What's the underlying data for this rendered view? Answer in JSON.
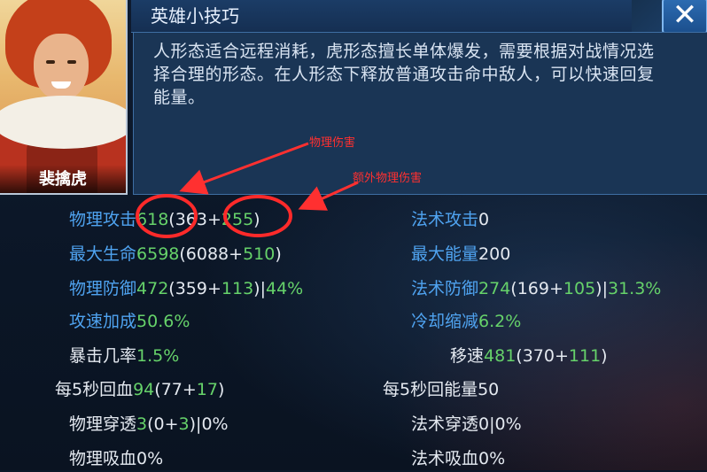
{
  "hero": {
    "name": "裴擒虎"
  },
  "tips": {
    "title": "英雄小技巧",
    "text": "人形态适合远程消耗，虎形态擅长单体爆发，需要根据对战情况选择合理的形态。在人形态下释放普通攻击命中敌人，可以快速回复能量。",
    "close_label": "✕"
  },
  "annotations": {
    "physical_damage": "物理伤害",
    "extra_physical_damage": "额外物理伤害"
  },
  "stats_left": [
    {
      "label": "物理攻击",
      "label_color": "blue",
      "parts": [
        {
          "t": "618",
          "c": "green"
        },
        {
          "t": "(363+",
          "c": "white"
        },
        {
          "t": "255",
          "c": "green"
        },
        {
          "t": ")",
          "c": "white"
        }
      ]
    },
    {
      "label": "最大生命",
      "label_color": "blue",
      "parts": [
        {
          "t": "6598",
          "c": "green"
        },
        {
          "t": "(6088+",
          "c": "white"
        },
        {
          "t": "510",
          "c": "green"
        },
        {
          "t": ")",
          "c": "white"
        }
      ]
    },
    {
      "label": "物理防御",
      "label_color": "blue",
      "parts": [
        {
          "t": "472",
          "c": "green"
        },
        {
          "t": "(359+",
          "c": "white"
        },
        {
          "t": "113",
          "c": "green"
        },
        {
          "t": ")|",
          "c": "white"
        },
        {
          "t": "44%",
          "c": "green"
        }
      ]
    },
    {
      "label": "攻速加成",
      "label_color": "blue",
      "parts": [
        {
          "t": "50.6%",
          "c": "green"
        }
      ]
    },
    {
      "label": "暴击几率",
      "label_color": "white",
      "parts": [
        {
          "t": "1.5%",
          "c": "green"
        }
      ]
    },
    {
      "label": "每5秒回血",
      "label_color": "white",
      "parts": [
        {
          "t": "94",
          "c": "green"
        },
        {
          "t": "(77+",
          "c": "white"
        },
        {
          "t": "17",
          "c": "green"
        },
        {
          "t": ")",
          "c": "white"
        }
      ]
    },
    {
      "label": "物理穿透",
      "label_color": "white",
      "parts": [
        {
          "t": "3",
          "c": "green"
        },
        {
          "t": "(0+",
          "c": "white"
        },
        {
          "t": "3",
          "c": "green"
        },
        {
          "t": ")|0%",
          "c": "white"
        }
      ]
    },
    {
      "label": "物理吸血",
      "label_color": "white",
      "parts": [
        {
          "t": "0%",
          "c": "white"
        }
      ]
    }
  ],
  "stats_right": [
    {
      "label": "法术攻击",
      "label_color": "blue",
      "parts": [
        {
          "t": "0",
          "c": "white"
        }
      ]
    },
    {
      "label": "最大能量",
      "label_color": "blue",
      "parts": [
        {
          "t": "200",
          "c": "white"
        }
      ]
    },
    {
      "label": "法术防御",
      "label_color": "blue",
      "parts": [
        {
          "t": "274",
          "c": "green"
        },
        {
          "t": "(169+",
          "c": "white"
        },
        {
          "t": "105",
          "c": "green"
        },
        {
          "t": ")|",
          "c": "white"
        },
        {
          "t": "31.3%",
          "c": "green"
        }
      ]
    },
    {
      "label": "冷却缩减",
      "label_color": "blue",
      "parts": [
        {
          "t": "6.2%",
          "c": "green"
        }
      ]
    },
    {
      "label": "移速",
      "label_color": "white",
      "parts": [
        {
          "t": "481",
          "c": "green"
        },
        {
          "t": "(370+",
          "c": "white"
        },
        {
          "t": "111",
          "c": "green"
        },
        {
          "t": ")",
          "c": "white"
        }
      ]
    },
    {
      "label": "每5秒回能量",
      "label_color": "white",
      "parts": [
        {
          "t": "50",
          "c": "white"
        }
      ]
    },
    {
      "label": "法术穿透",
      "label_color": "white",
      "parts": [
        {
          "t": "0|0%",
          "c": "white"
        }
      ]
    },
    {
      "label": "法术吸血",
      "label_color": "white",
      "parts": [
        {
          "t": "0%",
          "c": "white"
        }
      ]
    }
  ],
  "colors": {
    "label_blue": "#4fa3f0",
    "value_green": "#66d26a",
    "text_white": "#e4e9f0",
    "annotation_red": "#ff3030"
  }
}
